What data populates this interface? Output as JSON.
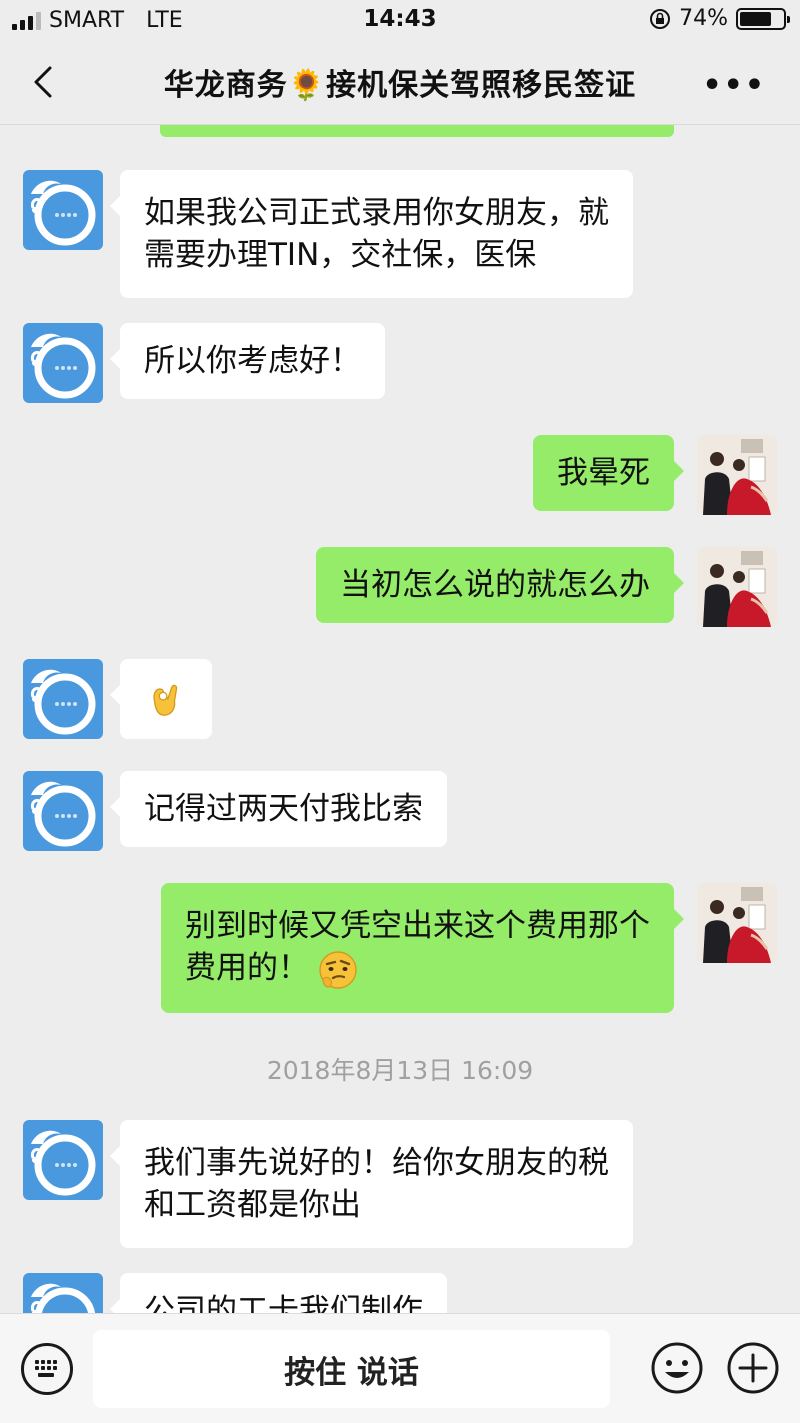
{
  "status_bar": {
    "carrier": "SMART",
    "network": "LTE",
    "time": "14:43",
    "battery": "74%",
    "battery_level": 0.74
  },
  "header": {
    "title": "华龙商务🌻接机保关驾照移民签证",
    "more": "•••"
  },
  "messages": [
    {
      "side": "in",
      "text_lines": [
        "如果我公司正式录用你女朋友，就",
        "需要办理TIN，交社保，医保"
      ]
    },
    {
      "side": "in",
      "text_lines": [
        "所以你考虑好！"
      ]
    },
    {
      "side": "out",
      "text_lines": [
        "我晕死"
      ]
    },
    {
      "side": "out",
      "text_lines": [
        "当初怎么说的就怎么办"
      ]
    },
    {
      "side": "in",
      "emoji": "ok-hand-emoji"
    },
    {
      "side": "in",
      "text_lines": [
        "记得过两天付我比索"
      ]
    },
    {
      "side": "out",
      "text_lines": [
        "别到时候又凭空出来这个费用那个",
        "费用的！"
      ],
      "trailing_emoji": "thinking-face-emoji"
    },
    {
      "timestamp": "2018年8月13日 16:09"
    },
    {
      "side": "in",
      "text_lines": [
        "我们事先说好的！给你女朋友的税",
        "和工资都是你出"
      ]
    },
    {
      "side": "in",
      "text_lines": [
        "公司的工卡我们制作"
      ]
    }
  ],
  "input_bar": {
    "hold_to_talk": "按住 说话"
  },
  "colors": {
    "background": "#ededed",
    "outgoing_bubble": "#95ec69",
    "incoming_bubble": "#ffffff",
    "logo_avatar": "#4a98dd",
    "timestamp_text": "#a0a0a0"
  }
}
